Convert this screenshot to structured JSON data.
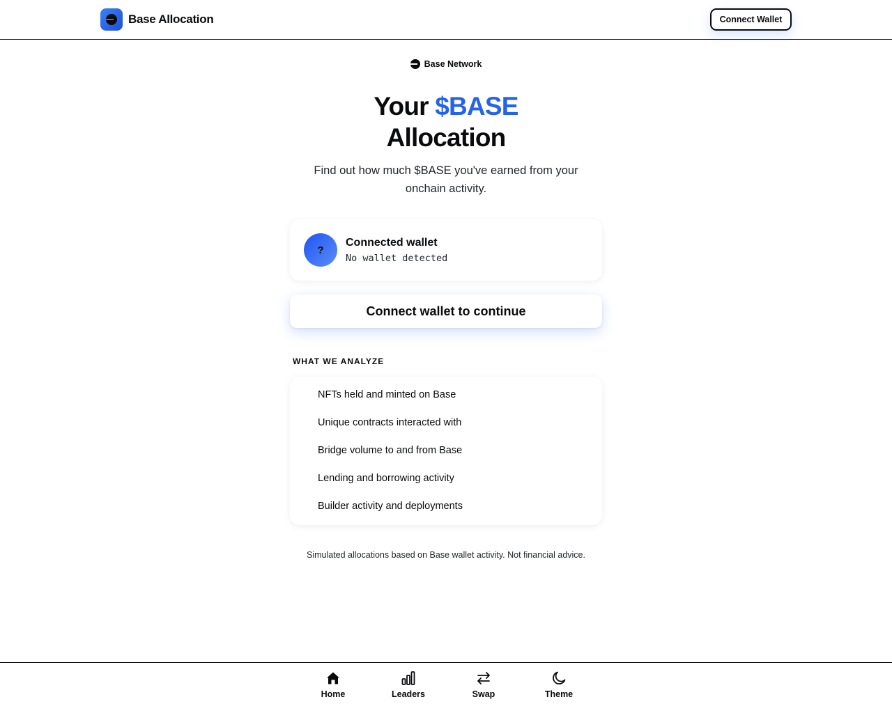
{
  "header": {
    "brand_name": "Base Allocation",
    "connect_label": "Connect Wallet"
  },
  "hero": {
    "network_label": "Base Network",
    "title_prefix": "Your ",
    "title_accent": "$BASE",
    "title_suffix": "Allocation",
    "subtitle": "Find out how much $BASE you've earned from your onchain activity."
  },
  "wallet": {
    "avatar_text": "?",
    "title": "Connected wallet",
    "status": "No wallet detected"
  },
  "continue_label": "Connect wallet to continue",
  "analyze": {
    "label": "WHAT WE ANALYZE",
    "items": [
      "NFTs held and minted on Base",
      "Unique contracts interacted with",
      "Bridge volume to and from Base",
      "Lending and borrowing activity",
      "Builder activity and deployments"
    ]
  },
  "disclaimer": "Simulated allocations based on Base wallet activity. Not financial advice.",
  "nav": {
    "items": [
      {
        "label": "Home",
        "icon": "home-icon"
      },
      {
        "label": "Leaders",
        "icon": "bar-chart-icon"
      },
      {
        "label": "Swap",
        "icon": "swap-icon"
      },
      {
        "label": "Theme",
        "icon": "moon-icon"
      }
    ]
  },
  "colors": {
    "accent": "#2563eb",
    "text": "#0a0b0d"
  }
}
